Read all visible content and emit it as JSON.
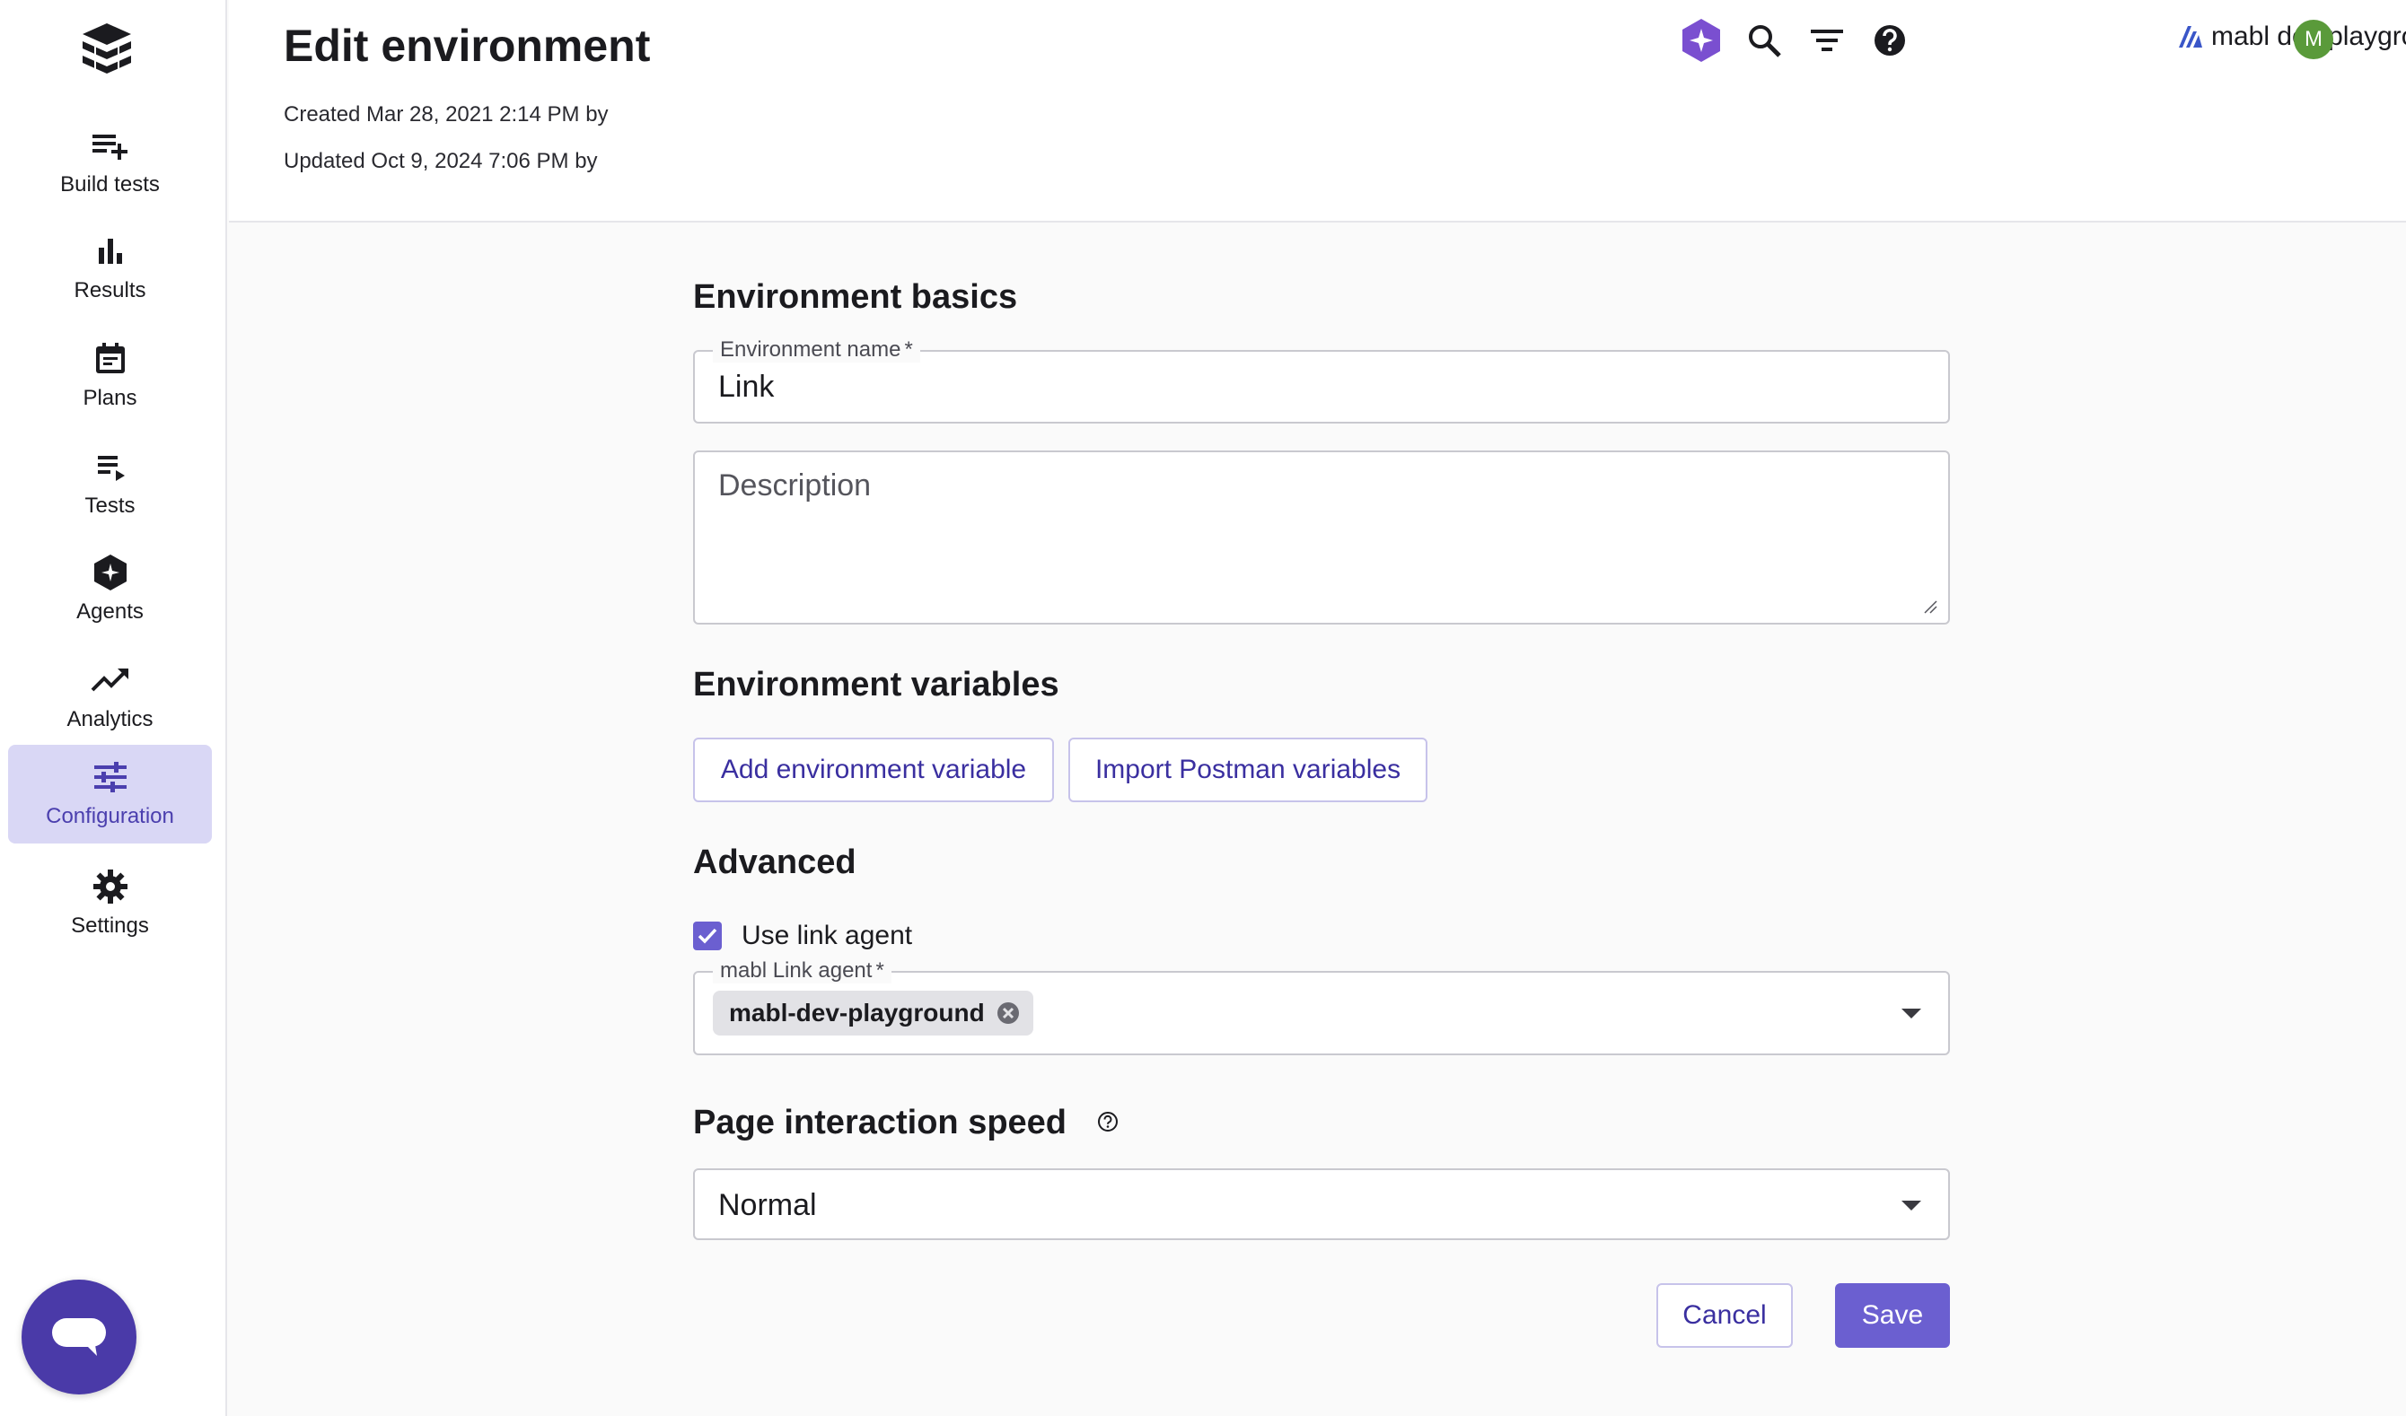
{
  "sidebar": {
    "items": [
      {
        "label": "Build tests",
        "icon": "build-tests-icon"
      },
      {
        "label": "Results",
        "icon": "results-bar-chart-icon"
      },
      {
        "label": "Plans",
        "icon": "calendar-icon"
      },
      {
        "label": "Tests",
        "icon": "playlist-icon"
      },
      {
        "label": "Agents",
        "icon": "agents-hexagon-icon"
      },
      {
        "label": "Analytics",
        "icon": "trending-up-icon"
      },
      {
        "label": "Configuration",
        "icon": "sliders-icon",
        "active": true
      },
      {
        "label": "Settings",
        "icon": "gear-icon"
      }
    ]
  },
  "header": {
    "title": "Edit environment",
    "created": "Created Mar 28, 2021 2:14 PM by",
    "updated": "Updated Oct 9, 2024 7:06 PM by",
    "workspace": "mabl dev playground",
    "avatar_initial": "M"
  },
  "form": {
    "basics_title": "Environment basics",
    "name_label": "Environment name",
    "required_mark": "*",
    "name_value": "Link",
    "description_placeholder": "Description",
    "variables_title": "Environment variables",
    "add_variable_label": "Add environment variable",
    "import_postman_label": "Import Postman variables",
    "advanced_title": "Advanced",
    "use_link_agent_label": "Use link agent",
    "use_link_agent_checked": true,
    "link_agent_label": "mabl Link agent",
    "link_agent_chip": "mabl-dev-playground",
    "speed_title": "Page interaction speed",
    "speed_value": "Normal",
    "cancel_label": "Cancel",
    "save_label": "Save"
  },
  "colors": {
    "accent": "#6b5fd0",
    "active_nav_bg": "#d9d7f5",
    "fab": "#4a3aa8",
    "avatar": "#5a9a3a"
  }
}
